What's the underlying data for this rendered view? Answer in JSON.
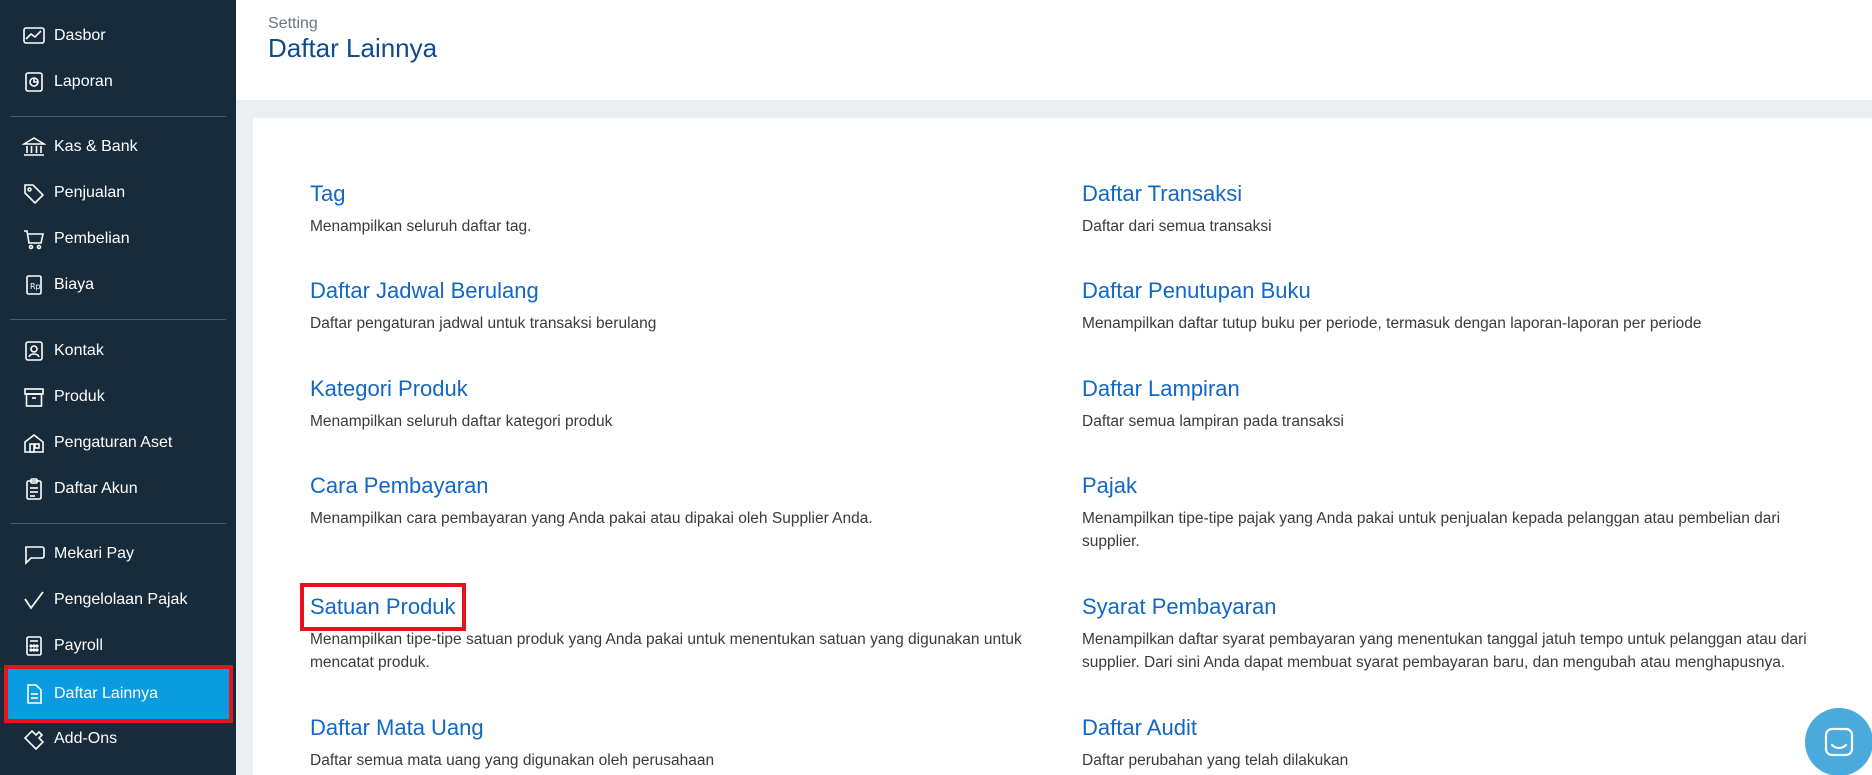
{
  "sidebar": {
    "items": [
      {
        "label": "Dasbor",
        "icon": "dashboard-icon"
      },
      {
        "label": "Laporan",
        "icon": "report-icon"
      },
      {
        "label": "Kas & Bank",
        "icon": "bank-icon"
      },
      {
        "label": "Penjualan",
        "icon": "tag-icon"
      },
      {
        "label": "Pembelian",
        "icon": "cart-icon"
      },
      {
        "label": "Biaya",
        "icon": "expense-icon"
      },
      {
        "label": "Kontak",
        "icon": "contact-icon"
      },
      {
        "label": "Produk",
        "icon": "product-box-icon"
      },
      {
        "label": "Pengaturan Aset",
        "icon": "asset-icon"
      },
      {
        "label": "Daftar Akun",
        "icon": "clipboard-list-icon"
      },
      {
        "label": "Mekari Pay",
        "icon": "chat-bubble-icon"
      },
      {
        "label": "Pengelolaan Pajak",
        "icon": "checkmark-icon"
      },
      {
        "label": "Payroll",
        "icon": "calculator-icon"
      },
      {
        "label": "Daftar Lainnya",
        "icon": "document-icon"
      },
      {
        "label": "Add-Ons",
        "icon": "puzzle-icon"
      }
    ]
  },
  "header": {
    "breadcrumb": "Setting",
    "title": "Daftar Lainnya"
  },
  "entries": {
    "left": [
      {
        "title": "Tag",
        "desc": "Menampilkan seluruh daftar tag."
      },
      {
        "title": "Daftar Jadwal Berulang",
        "desc": "Daftar pengaturan jadwal untuk transaksi berulang"
      },
      {
        "title": "Kategori Produk",
        "desc": "Menampilkan seluruh daftar kategori produk"
      },
      {
        "title": "Cara Pembayaran",
        "desc": "Menampilkan cara pembayaran yang Anda pakai atau dipakai oleh Supplier Anda."
      },
      {
        "title": "Satuan Produk",
        "desc": "Menampilkan tipe-tipe satuan produk yang Anda pakai untuk menentukan satuan yang digunakan untuk mencatat produk."
      },
      {
        "title": "Daftar Mata Uang",
        "desc": "Daftar semua mata uang yang digunakan oleh perusahaan"
      }
    ],
    "right": [
      {
        "title": "Daftar Transaksi",
        "desc": "Daftar dari semua transaksi"
      },
      {
        "title": "Daftar Penutupan Buku",
        "desc": "Menampilkan daftar tutup buku per periode, termasuk dengan laporan-laporan per periode"
      },
      {
        "title": "Daftar Lampiran",
        "desc": "Daftar semua lampiran pada transaksi"
      },
      {
        "title": "Pajak",
        "desc": "Menampilkan tipe-tipe pajak yang Anda pakai untuk penjualan kepada pelanggan atau pembelian dari supplier."
      },
      {
        "title": "Syarat Pembayaran",
        "desc": "Menampilkan daftar syarat pembayaran yang menentukan tanggal jatuh tempo untuk pelanggan atau dari supplier. Dari sini Anda dapat membuat syarat pembayaran baru, dan mengubah atau menghapusnya."
      },
      {
        "title": "Daftar Audit",
        "desc": "Daftar perubahan yang telah dilakukan"
      }
    ]
  },
  "colors": {
    "sidebar_bg": "#172b3a",
    "active_bg": "#0a9be0",
    "highlight": "#e3141b",
    "link": "#1167c6",
    "title": "#0f4a8c"
  },
  "chat_widget": {
    "icon": "chat-launcher-icon"
  }
}
